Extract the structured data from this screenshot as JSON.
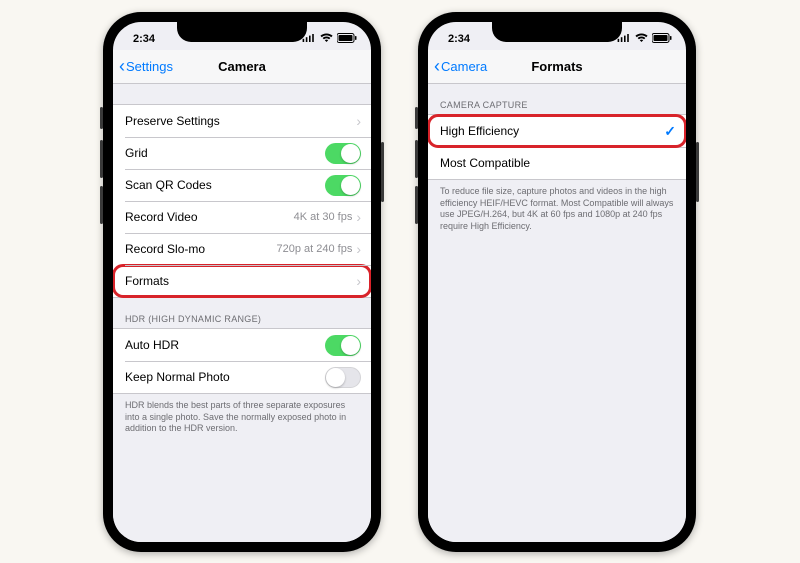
{
  "status": {
    "time": "2:34",
    "loc_glyph": "➤",
    "wifi_glyph": "􀙇",
    "battery_glyph": "■"
  },
  "phone_left": {
    "nav": {
      "back": "Settings",
      "title": "Camera"
    },
    "group1": {
      "preserve": "Preserve Settings",
      "grid": "Grid",
      "scanqr": "Scan QR Codes",
      "rec_video": {
        "label": "Record Video",
        "detail": "4K at 30 fps"
      },
      "rec_slomo": {
        "label": "Record Slo-mo",
        "detail": "720p at 240 fps"
      },
      "formats": "Formats"
    },
    "hdr_header": "HDR (HIGH DYNAMIC RANGE)",
    "group2": {
      "auto_hdr": "Auto HDR",
      "keep_normal": "Keep Normal Photo"
    },
    "hdr_footer": "HDR blends the best parts of three separate exposures into a single photo. Save the normally exposed photo in addition to the HDR version."
  },
  "phone_right": {
    "nav": {
      "back": "Camera",
      "title": "Formats"
    },
    "capture_header": "CAMERA CAPTURE",
    "group": {
      "high_eff": "High Efficiency",
      "most_compat": "Most Compatible"
    },
    "capture_footer": "To reduce file size, capture photos and videos in the high efficiency HEIF/HEVC format. Most Compatible will always use JPEG/H.264, but 4K at 60 fps and 1080p at 240 fps require High Efficiency."
  }
}
